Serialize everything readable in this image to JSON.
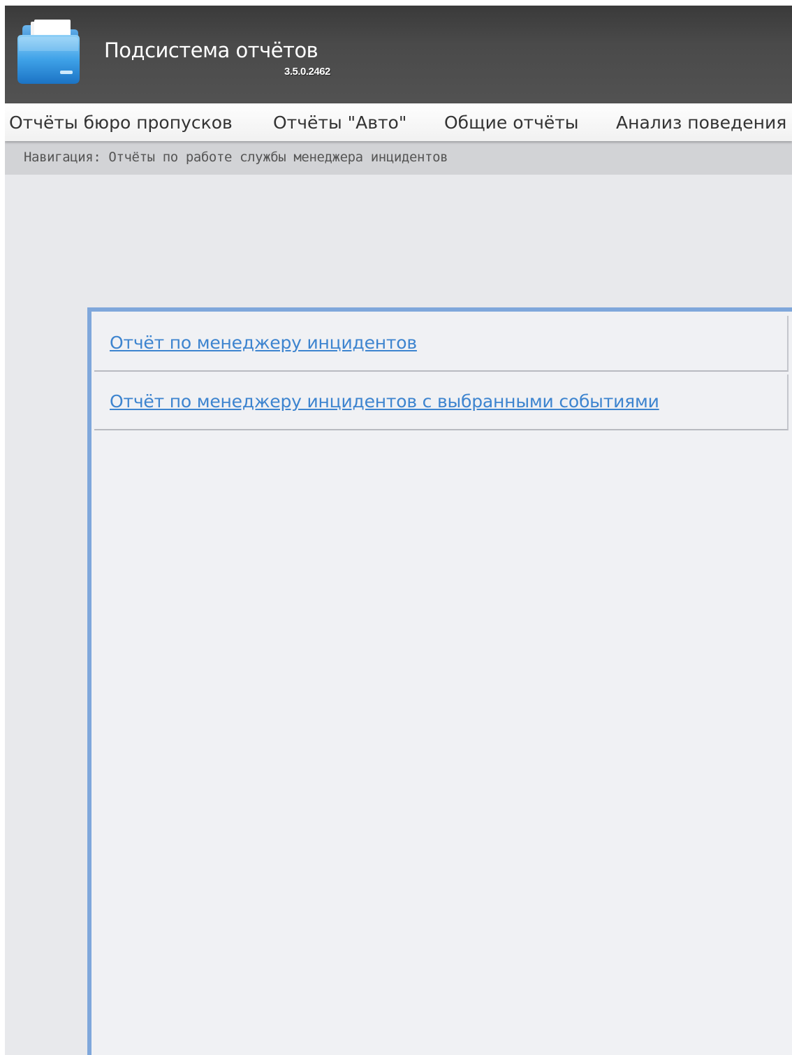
{
  "header": {
    "title": "Подсистема отчётов",
    "version": "3.5.0.2462",
    "logo_icon": "folder-icon"
  },
  "menu": {
    "items": [
      {
        "label": "Отчёты бюро пропусков"
      },
      {
        "label": "Отчёты \"Авто\""
      },
      {
        "label": "Общие отчёты"
      },
      {
        "label": "Анализ поведения"
      }
    ]
  },
  "breadcrumb": {
    "text": "Навигация: Отчёты по работе службы менеджера инцидентов"
  },
  "reports": {
    "items": [
      {
        "label": "Отчёт по менеджеру инцидентов"
      },
      {
        "label": "Отчёт по менеджеру инцидентов с выбранными событиями"
      }
    ]
  },
  "colors": {
    "header_bg": "#4a4a4a",
    "accent": "#7fa7db",
    "link": "#3d84cf"
  }
}
